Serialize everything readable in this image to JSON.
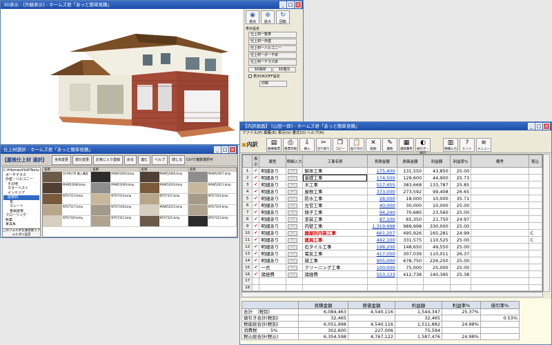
{
  "win3d": {
    "title": "3D表示 - [外観表示] - ホームズ君「あっと簡単見積」"
  },
  "side": {
    "top_icons": [
      {
        "label": "視点",
        "icon": "eye-icon"
      },
      {
        "label": "拡大",
        "icon": "zoom-icon"
      },
      {
        "label": "回転",
        "icon": "rotate-icon"
      }
    ],
    "section1": "表示設定",
    "buttons": [
      "仕上材一覧表",
      "仕上材一外壁",
      "仕上材一バルコニー",
      "仕上材一ポーチ床",
      "仕上材一テラス床"
    ],
    "small_buttons": [
      "3D保存",
      "3D復元"
    ],
    "checkbox": "表示OK/OFF設定",
    "print": "印刷"
  },
  "winmat": {
    "title": "仕上材選択 - ホームズ君「あっと簡単見積」",
    "panel_title": "【屋根仕上材 選択】",
    "buttons": [
      "全体変更",
      "部分変更",
      "お気に入り登録",
      "戻る",
      "進む",
      "ヘルプ",
      "閉じる"
    ],
    "note": "Ctrlで複数選択可",
    "tree": [
      "C:¥Homes¥3d¥Texture",
      "ポーチテラス",
      "外壁・バルコニー",
      "その他",
      "カラーベスト",
      "インテリア",
      "屋根材",
      "瓦",
      "スレート",
      "金属屋根",
      "フローリング",
      "新築",
      "家具系"
    ],
    "tree_button": "このフォルダを通常使うフォルダに設定",
    "grid_headers": [
      "名称",
      "説明",
      "名称",
      "説明",
      "名称",
      "説明",
      "名称",
      "説明"
    ],
    "grid": [
      [
        "10 MG-FR 最上構造",
        "MAW52004.bmp",
        "MAW52006.bmp",
        "MAW52007.bmp"
      ],
      [
        "MAW52008.bmp",
        "MAW52009.bmp",
        "MAW52010.bmp",
        "MAW52011.bmp"
      ],
      [
        "NTO7313.bmp",
        "NTO7314.bmp",
        "NTO7315.bmp",
        "NTO7316.bmp"
      ],
      [
        "NTO7317.bmp",
        "NTO7318.bmp",
        "MAW52015.bmp",
        "NTO7319.bmp"
      ],
      [
        "NTO7320.bmp",
        "NTO7321.bmp",
        "NTO7322.bmp",
        "NTO7323.bmp"
      ]
    ],
    "swatch_colors": [
      "#6b5a48",
      "#2b2b2b",
      "#4f3f35",
      "#8d8d8d",
      "#7a5a3a",
      "#c8b89a",
      "#b8a688",
      "#a49a8a",
      "#d6cfc0",
      "#b0a490"
    ]
  },
  "winest": {
    "title": "【内訳画面】 [山田一郎] - ホームズ君「あっと簡単見積」",
    "menu": "ファイル(F)  編集(E)  表示(V)  書式(O)  ヘルプ(H)",
    "page_title": "内訳",
    "toolbar": [
      {
        "label": "摘要帳票",
        "icon": "doc-icon",
        "g": "▤"
      },
      {
        "label": "帳票印刷",
        "icon": "print-icon",
        "g": "⎙"
      },
      {
        "label": "挿入",
        "icon": "insert-icon",
        "g": "⇩"
      },
      {
        "label": "切り取り",
        "icon": "cut-icon",
        "g": "✂"
      },
      {
        "label": "コピー",
        "icon": "copy-icon",
        "g": "❐"
      },
      {
        "label": "貼り付け",
        "icon": "paste-icon",
        "g": "📋"
      },
      {
        "label": "削除",
        "icon": "delete-icon",
        "g": "✕"
      },
      {
        "label": "属性",
        "icon": "attr-icon",
        "g": "✎"
      },
      {
        "label": "諸経費率",
        "icon": "rate-icon",
        "g": "▦"
      },
      {
        "label": "値引き・総計",
        "icon": "discount-icon",
        "g": "◐"
      },
      {
        "label": "明細入力",
        "icon": "detail-icon",
        "g": "▥"
      },
      {
        "label": "ヒント",
        "icon": "hint-icon",
        "g": "?"
      },
      {
        "label": "メニュー",
        "icon": "menu-icon",
        "g": "≡"
      }
    ],
    "headers": [
      "表示",
      "属性",
      "明細入力",
      "工事名称",
      "見積金額",
      "原価金額",
      "利益額",
      "利益率%",
      "備考",
      "取込"
    ],
    "rows": [
      {
        "n": "1",
        "attr": "明細あり",
        "name": "解体工事",
        "est": "175,400",
        "cost": "131,550",
        "profit": "43,850",
        "rate": "25.00",
        "note": "",
        "take": ""
      },
      {
        "n": "2",
        "attr": "明細あり",
        "name": "基礎工事",
        "est": "174,500",
        "cost": "129,600",
        "profit": "44,900",
        "rate": "25.73",
        "note": "",
        "take": ""
      },
      {
        "n": "3",
        "attr": "明細あり",
        "name": "木工事",
        "est": "517,455",
        "cost": "383,668",
        "profit": "133,787",
        "rate": "25.85",
        "note": "",
        "take": ""
      },
      {
        "n": "4",
        "attr": "明細あり",
        "name": "屋根工事",
        "est": "373,000",
        "cost": "273,592",
        "profit": "99,408",
        "rate": "26.65",
        "note": "",
        "take": ""
      },
      {
        "n": "5",
        "attr": "明細あり",
        "name": "防水工事",
        "est": "28,000",
        "cost": "18,000",
        "profit": "10,000",
        "rate": "35.71",
        "note": "",
        "take": ""
      },
      {
        "n": "6",
        "attr": "明細あり",
        "name": "左官工事",
        "est": "40,000",
        "cost": "30,000",
        "profit": "10,000",
        "rate": "25.00",
        "note": "",
        "take": ""
      },
      {
        "n": "7",
        "attr": "明細あり",
        "name": "鋳子工事",
        "est": "94,240",
        "cost": "70,680",
        "profit": "23,560",
        "rate": "25.00",
        "note": "",
        "take": ""
      },
      {
        "n": "8",
        "attr": "明細あり",
        "name": "塗装工事",
        "est": "87,100",
        "cost": "65,350",
        "profit": "21,750",
        "rate": "24.97",
        "note": "",
        "take": ""
      },
      {
        "n": "9",
        "attr": "明細あり",
        "name": "内壁工事",
        "est": "1,319,998",
        "cost": "989,998",
        "profit": "330,000",
        "rate": "25.00",
        "note": "",
        "take": ""
      },
      {
        "n": "10",
        "attr": "明細あり",
        "name": "器屋別内装工事",
        "est": "661,207",
        "cost": "495,926",
        "profit": "165,281",
        "rate": "24.99",
        "note": "",
        "take": "C"
      },
      {
        "n": "11",
        "attr": "明細あり",
        "name": "建具工事",
        "est": "442,100",
        "cost": "331,575",
        "profit": "110,525",
        "rate": "25.00",
        "note": "",
        "take": "C"
      },
      {
        "n": "12",
        "attr": "明細あり",
        "name": "石タイル工事",
        "est": "198,200",
        "cost": "148,650",
        "profit": "49,550",
        "rate": "25.00",
        "note": "",
        "take": ""
      },
      {
        "n": "13",
        "attr": "明細あり",
        "name": "電気工事",
        "est": "417,050",
        "cost": "307,039",
        "profit": "110,011",
        "rate": "26.37",
        "note": "",
        "take": ""
      },
      {
        "n": "14",
        "attr": "明細あり",
        "name": "雑工事",
        "est": "905,000",
        "cost": "678,750",
        "profit": "226,250",
        "rate": "25.00",
        "note": "",
        "take": ""
      },
      {
        "n": "15",
        "attr": "一式",
        "name": "クリーニング工事",
        "est": "100,000",
        "cost": "75,000",
        "profit": "25,000",
        "rate": "25.00",
        "note": "",
        "take": ""
      },
      {
        "n": "16",
        "attr": "諸経費",
        "name": "諸経費",
        "est": "553,133",
        "cost": "412,738",
        "profit": "140,395",
        "rate": "25.38",
        "note": "",
        "take": ""
      },
      {
        "n": "17",
        "attr": "",
        "name": "",
        "est": "",
        "cost": "",
        "profit": "",
        "rate": "",
        "note": "",
        "take": ""
      },
      {
        "n": "18",
        "attr": "",
        "name": "",
        "est": "",
        "cost": "",
        "profit": "",
        "rate": "",
        "note": "",
        "take": ""
      }
    ],
    "totals_headers": [
      "",
      "見積金額",
      "原価金額",
      "利益額",
      "利益率%",
      "値引率%"
    ],
    "totals": [
      [
        "合計　（税別）",
        "6,084,463",
        "4,540,116",
        "1,544,347",
        "25.37%",
        ""
      ],
      [
        "値引き合計(税別)",
        "32,465",
        "",
        "32,465",
        "",
        "0.53%"
      ],
      [
        "税抜総合計(税別)",
        "6,051,998",
        "4,540,116",
        "1,511,882",
        "24.98%",
        ""
      ],
      [
        "消費税　　　5%",
        "302,600",
        "227,006",
        "75,594",
        "",
        ""
      ],
      [
        "税込総合計(税込)",
        "6,354,598",
        "4,767,122",
        "1,587,476",
        "24.98%",
        ""
      ]
    ]
  }
}
